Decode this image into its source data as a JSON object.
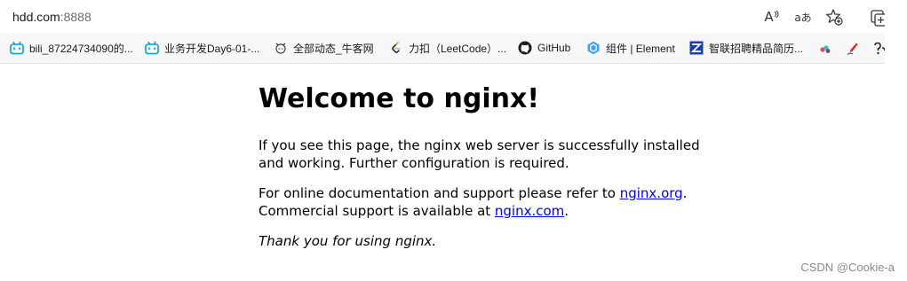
{
  "browser": {
    "url_host": "hdd.com",
    "url_port": ":8888",
    "read_aloud_glyph": "A",
    "translate_glyph": "aあ"
  },
  "bookmarks": [
    {
      "label": "bili_87224734090的...",
      "icon": "bilibili-icon"
    },
    {
      "label": "业务开发Day6-01-...",
      "icon": "bilibili-icon"
    },
    {
      "label": "全部动态_牛客网",
      "icon": "nowcoder-icon"
    },
    {
      "label": "力扣（LeetCode）...",
      "icon": "leetcode-icon"
    },
    {
      "label": "GitHub",
      "icon": "github-icon"
    },
    {
      "label": "组件 | Element",
      "icon": "element-icon"
    },
    {
      "label": "智联招聘精品简历...",
      "icon": "zhaopin-icon"
    }
  ],
  "page": {
    "heading": "Welcome to nginx!",
    "p1": "If you see this page, the nginx web server is successfully installed and working. Further configuration is required.",
    "p2_before": "For online documentation and support please refer to ",
    "p2_link": "nginx.org",
    "p2_middle": ".",
    "p2_line2": "Commercial support is available at ",
    "p2_link2": "nginx.com",
    "p2_end": ".",
    "p3": "Thank you for using nginx."
  },
  "watermark": "CSDN @Cookie-a",
  "colors": {
    "link": "#0000ee",
    "bilibili": "#00a1d6",
    "github": "#1b1f23",
    "leetcode": "#ffa116",
    "element": "#409eff",
    "zhaopin": "#1c3fa8"
  }
}
